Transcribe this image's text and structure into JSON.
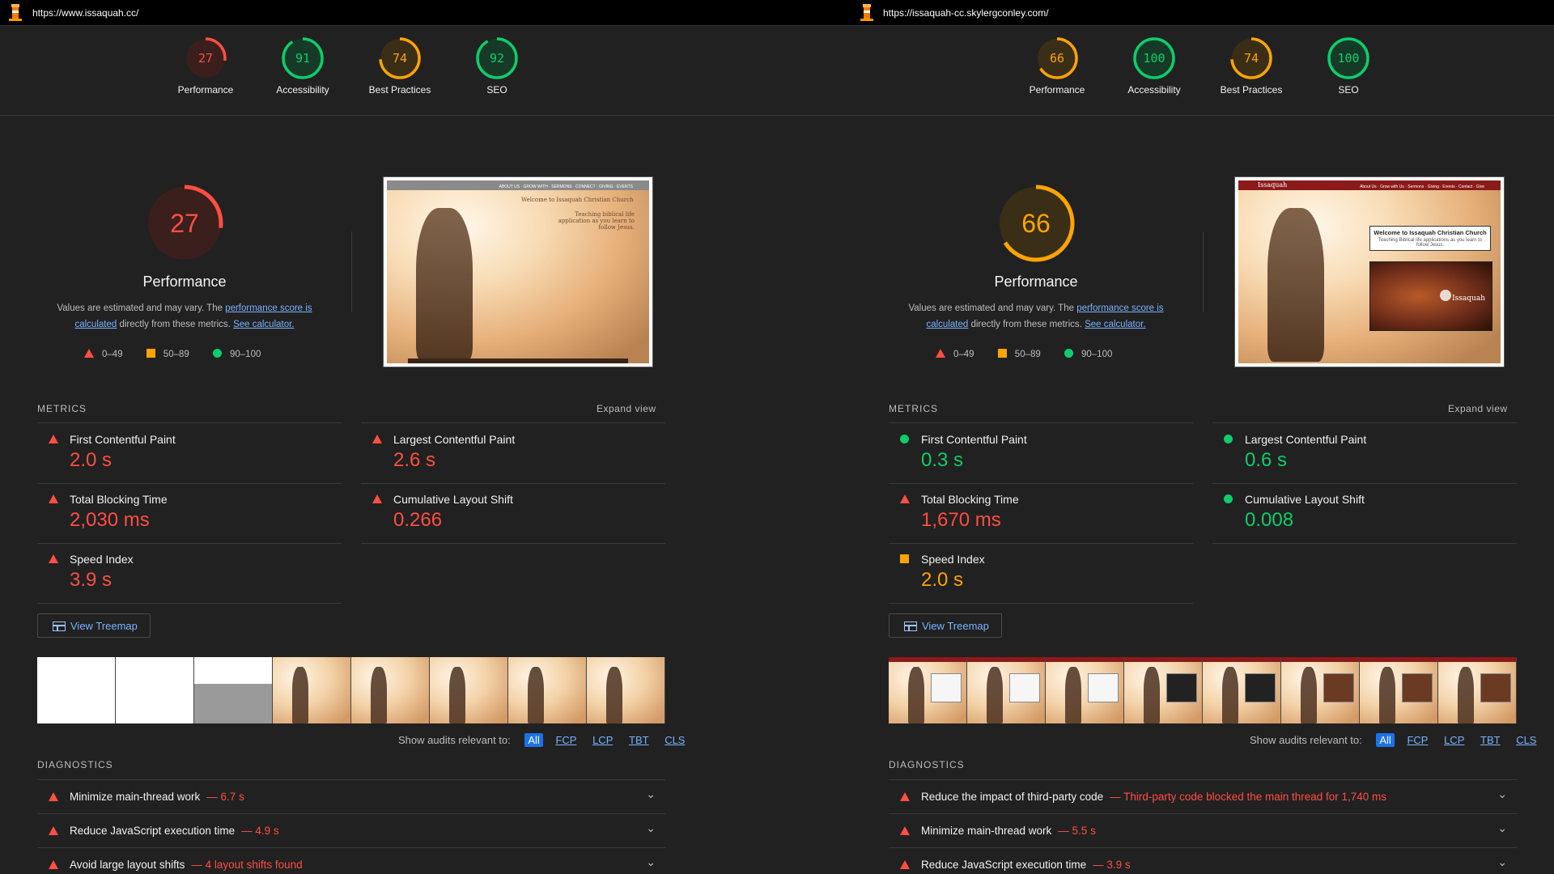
{
  "colors": {
    "fail": "#ff4e42",
    "average": "#ffa400",
    "pass": "#0cce6b",
    "link": "#7ab3ff",
    "bg": "#212121"
  },
  "left": {
    "url": "https://www.issaquah.cc/",
    "gauges": [
      {
        "label": "Performance",
        "score": "27",
        "rating": "fail"
      },
      {
        "label": "Accessibility",
        "score": "91",
        "rating": "pass"
      },
      {
        "label": "Best Practices",
        "score": "74",
        "rating": "average"
      },
      {
        "label": "SEO",
        "score": "92",
        "rating": "pass"
      }
    ],
    "perf_score": "27",
    "perf_rating": "fail",
    "screenshot": {
      "nav_text": "ABOUT US · GROW WITH · SERMONS · CONNECT · GIVING · EVENTS",
      "title": "Welcome to Issaquah Christian Church",
      "subtitle": "Teaching biblical life application as you learn to follow Jesus."
    },
    "metrics": [
      {
        "name": "First Contentful Paint",
        "value": "2.0 s",
        "rating": "fail"
      },
      {
        "name": "Largest Contentful Paint",
        "value": "2.6 s",
        "rating": "fail"
      },
      {
        "name": "Total Blocking Time",
        "value": "2,030 ms",
        "rating": "fail"
      },
      {
        "name": "Cumulative Layout Shift",
        "value": "0.266",
        "rating": "fail"
      },
      {
        "name": "Speed Index",
        "value": "3.9 s",
        "rating": "fail"
      }
    ],
    "diagnostics": [
      {
        "title": "Minimize main-thread work",
        "display": "— 6.7 s"
      },
      {
        "title": "Reduce JavaScript execution time",
        "display": "— 4.9 s"
      },
      {
        "title": "Avoid large layout shifts",
        "display": "— 4 layout shifts found"
      }
    ]
  },
  "right": {
    "url": "https://issaquah-cc.skylergconley.com/",
    "gauges": [
      {
        "label": "Performance",
        "score": "66",
        "rating": "average"
      },
      {
        "label": "Accessibility",
        "score": "100",
        "rating": "pass"
      },
      {
        "label": "Best Practices",
        "score": "74",
        "rating": "average"
      },
      {
        "label": "SEO",
        "score": "100",
        "rating": "pass"
      }
    ],
    "perf_score": "66",
    "perf_rating": "average",
    "screenshot": {
      "brand": "Issaquah",
      "nav_text": "About Us · Grow with Us · Sermons · Giving · Events · Contact · Give",
      "title": "Welcome to Issaquah Christian Church",
      "subtitle": "Teaching Biblical life applications as you learn to follow Jesus.",
      "video_label": "Issaquah"
    },
    "metrics": [
      {
        "name": "First Contentful Paint",
        "value": "0.3 s",
        "rating": "pass"
      },
      {
        "name": "Largest Contentful Paint",
        "value": "0.6 s",
        "rating": "pass"
      },
      {
        "name": "Total Blocking Time",
        "value": "1,670 ms",
        "rating": "fail"
      },
      {
        "name": "Cumulative Layout Shift",
        "value": "0.008",
        "rating": "pass"
      },
      {
        "name": "Speed Index",
        "value": "2.0 s",
        "rating": "average"
      }
    ],
    "diagnostics": [
      {
        "title": "Reduce the impact of third-party code",
        "display": "— Third-party code blocked the main thread for 1,740 ms"
      },
      {
        "title": "Minimize main-thread work",
        "display": "— 5.5 s"
      },
      {
        "title": "Reduce JavaScript execution time",
        "display": "— 3.9 s"
      }
    ]
  },
  "common": {
    "perf_title": "Performance",
    "desc_prefix": "Values are estimated and may vary. The ",
    "desc_link1": "performance score is calculated",
    "desc_mid": " directly from these metrics. ",
    "desc_link2": "See calculator.",
    "legend": [
      "0–49",
      "50–89",
      "90–100"
    ],
    "metrics_heading": "METRICS",
    "expand_view": "Expand view",
    "view_treemap": "View Treemap",
    "show_audits": "Show audits relevant to:",
    "audit_filters": [
      "All",
      "FCP",
      "LCP",
      "TBT",
      "CLS"
    ],
    "diagnostics_heading": "DIAGNOSTICS"
  }
}
